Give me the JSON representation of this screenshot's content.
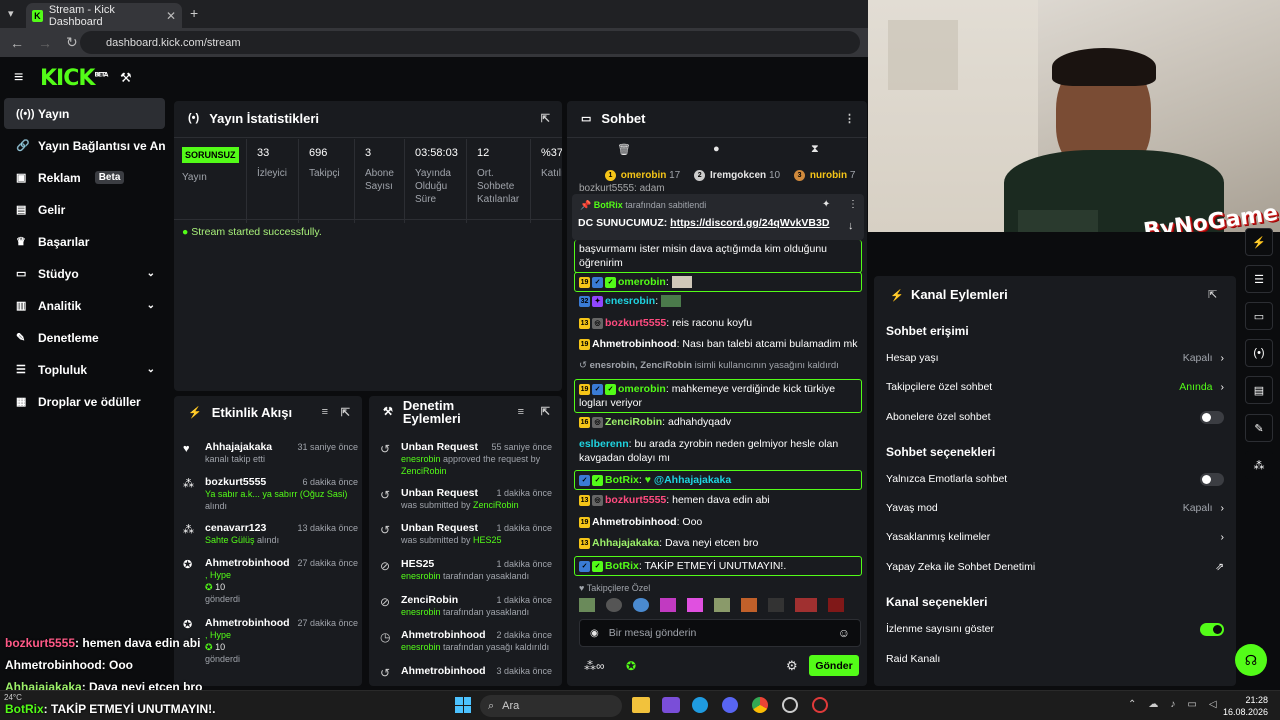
{
  "browser": {
    "tab_title": "Stream - Kick Dashboard",
    "url": "dashboard.kick.com/stream"
  },
  "brand": {
    "logo": "KICK",
    "logo_sup": "BETA",
    "accent": "#53fc18"
  },
  "nav": {
    "items": [
      {
        "label": "Yayın",
        "icon": "broadcast-icon"
      },
      {
        "label": "Yayın Bağlantısı ve Anahtarı",
        "icon": "link-icon"
      },
      {
        "label": "Reklam",
        "badge": "Beta",
        "icon": "ad-icon"
      },
      {
        "label": "Gelir",
        "icon": "chart-icon"
      },
      {
        "label": "Başarılar",
        "icon": "trophy-icon"
      },
      {
        "label": "Stüdyo",
        "icon": "studio-icon"
      },
      {
        "label": "Analitik",
        "icon": "analytics-icon"
      },
      {
        "label": "Denetleme",
        "icon": "wrench-icon"
      },
      {
        "label": "Topluluk",
        "icon": "community-icon"
      },
      {
        "label": "Droplar ve ödüller",
        "icon": "gift-icon"
      }
    ]
  },
  "stats": {
    "title": "Yayın İstatistikleri",
    "status": "SORUNSUZ",
    "status_label": "Yayın",
    "cols": [
      {
        "value": "33",
        "label": "İzleyici"
      },
      {
        "value": "696",
        "label": "Takipçi"
      },
      {
        "value": "3",
        "label": "Abone Sayısı"
      },
      {
        "value": "03:58:03",
        "label": "Yayında Olduğu Süre"
      },
      {
        "value": "12",
        "label": "Ort. Sohbete Katılanlar"
      },
      {
        "value": "%37",
        "label": "Katılı"
      }
    ],
    "success": "Stream started successfully."
  },
  "activity": {
    "title": "Etkinlik Akışı",
    "items": [
      {
        "name": "Ahhajajakaka",
        "time": "31 saniye önce",
        "line1": "kanalı takip etti",
        "line2": "",
        "line3": ""
      },
      {
        "name": "bozkurt5555",
        "time": "6 dakika önce",
        "line1": "Ya sabır a.k... ya sabırr (Oğuz Sasi)",
        "line2": "alındı",
        "line3": ""
      },
      {
        "name": "cenavarr123",
        "time": "13 dakika önce",
        "line1": "Sahte Gülüş",
        "line2": "alındı",
        "line3": ""
      },
      {
        "name": "Ahmetrobinhood",
        "time": "27 dakika önce",
        "line1": ", Hype",
        "line2": "10",
        "line3": "gönderdi"
      },
      {
        "name": "Ahmetrobinhood",
        "time": "27 dakika önce",
        "line1": ", Hype",
        "line2": "10",
        "line3": "gönderdi"
      },
      {
        "name": "Ahmetrobinhood",
        "time": "27 dakika önce",
        "line1": "",
        "line2": "",
        "line3": ""
      }
    ]
  },
  "moderation": {
    "title": "Denetim Eylemleri",
    "items": [
      {
        "name": "Unban Request",
        "time": "55 saniye önce",
        "who": "enesrobin",
        "desc": "approved the request by",
        "who2": "ZenciRobin"
      },
      {
        "name": "Unban Request",
        "time": "1 dakika önce",
        "who": "",
        "desc": "was submitted by",
        "who2": "ZenciRobin"
      },
      {
        "name": "Unban Request",
        "time": "1 dakika önce",
        "who": "",
        "desc": "was submitted by",
        "who2": "HES25"
      },
      {
        "name": "HES25",
        "time": "1 dakika önce",
        "who": "enesrobin",
        "desc": "tarafından yasaklandı",
        "who2": ""
      },
      {
        "name": "ZenciRobin",
        "time": "1 dakika önce",
        "who": "enesrobin",
        "desc": "tarafından yasaklandı",
        "who2": ""
      },
      {
        "name": "Ahmetrobinhood",
        "time": "2 dakika önce",
        "who": "enesrobin",
        "desc": "tarafından yasağı kaldırıldı",
        "who2": ""
      },
      {
        "name": "Ahmetrobinhood",
        "time": "3 dakika önce",
        "who": "",
        "desc": "",
        "who2": ""
      }
    ]
  },
  "chat": {
    "title": "Sohbet",
    "leaders": [
      {
        "rank": "1",
        "name": "omerobin",
        "count": "17"
      },
      {
        "rank": "2",
        "name": "Iremgokcen",
        "count": "10"
      },
      {
        "rank": "3",
        "name": "nurobin",
        "count": "7"
      }
    ],
    "pinned": {
      "by": "BotRix",
      "by_suffix": "tarafından sabitlendi",
      "label": "DC SUNUCUMUZ:",
      "link": "https://discord.gg/24qWvkVB3D"
    },
    "partial_top": "bozkurt5555: adam",
    "partial_msg": "başvurmamı ister misin dava açtığımda kim olduğunu öğrenirim",
    "messages": [
      {
        "badge": "19",
        "user": "omerobin",
        "text": "",
        "color": "green",
        "hl": true
      },
      {
        "badge": "32",
        "user": "enesrobin",
        "text": "",
        "color": "cyan",
        "hl": false
      },
      {
        "badge": "13",
        "user": "bozkurt5555",
        "text": "reis raconu koyfu",
        "color": "pink",
        "hl": false
      },
      {
        "badge": "19",
        "user": "Ahmetrobinhood",
        "text": "Nası ban talebi atcami bulamadim mk",
        "color": "white",
        "hl": false
      },
      {
        "badge": "19",
        "user": "omerobin",
        "text": "mahkemeye verdiğinde kick türkiye logları veriyor",
        "color": "green",
        "hl": true
      },
      {
        "badge": "16",
        "user": "ZenciRobin",
        "text": "adhahdyqadv",
        "color": "green",
        "hl": false
      },
      {
        "badge": "",
        "user": "eslberenn",
        "text": "bu arada zyrobin neden gelmiyor hesle olan kavgadan dolayı mı",
        "color": "cyan",
        "hl": false
      },
      {
        "badge": "",
        "user": "BotRix",
        "text": "@Ahhajajakaka",
        "color": "green",
        "hl": true
      },
      {
        "badge": "13",
        "user": "bozkurt5555",
        "text": "hemen dava edin abi",
        "color": "pink",
        "hl": false
      },
      {
        "badge": "19",
        "user": "Ahmetrobinhood",
        "text": "Ooo",
        "color": "white",
        "hl": false
      },
      {
        "badge": "13",
        "user": "Ahhajajakaka",
        "text": "Dava neyi etcen bro",
        "color": "green",
        "hl": false
      },
      {
        "badge": "",
        "user": "BotRix",
        "text": "TAKİP ETMEYİ UNUTMAYIN!.",
        "color": "green",
        "hl": true
      }
    ],
    "system_msg_names": "enesrobin, ZenciRobin",
    "system_msg": "isimli kullanıcının yasağını kaldırdı",
    "followers_only": "Takipçilere Özel",
    "input_placeholder": "Bir mesaj gönderin",
    "send": "Gönder"
  },
  "channel_actions": {
    "title": "Kanal Eylemleri",
    "sec1": "Sohbet erişimi",
    "rows1": [
      {
        "label": "Hesap yaşı",
        "value": "Kapalı"
      },
      {
        "label": "Takipçilere özel sohbet",
        "value": "Anında"
      },
      {
        "label": "Abonelere özel sohbet",
        "value": ""
      }
    ],
    "sec2": "Sohbet seçenekleri",
    "rows2": [
      {
        "label": "Yalnızca Emotlarla sohbet",
        "value": ""
      },
      {
        "label": "Yavaş mod",
        "value": "Kapalı"
      },
      {
        "label": "Yasaklanmış kelimeler",
        "value": ""
      },
      {
        "label": "Yapay Zeka ile Sohbet Denetimi",
        "value": ""
      }
    ],
    "sec3": "Kanal seçenekleri",
    "rows3": [
      {
        "label": "İzlenme sayısını göster",
        "value": ""
      },
      {
        "label": "Raid Kanalı",
        "value": ""
      }
    ]
  },
  "overlay": [
    {
      "user": "bozkurt5555",
      "text": ": hemen dava edin abi"
    },
    {
      "user": "Ahmetrobinhood",
      "text": ": Ooo"
    },
    {
      "user": "Ahhajajakaka",
      "text": ": Dava neyi etcen bro"
    },
    {
      "user": "BotRix",
      "text": ": TAKİP ETMEYİ UNUTMAYIN!."
    }
  ],
  "watermark": "ByNoGame",
  "taskbar": {
    "search": "Ara",
    "time": "21:28",
    "date": "16.08.2026",
    "weather": "24°C"
  }
}
